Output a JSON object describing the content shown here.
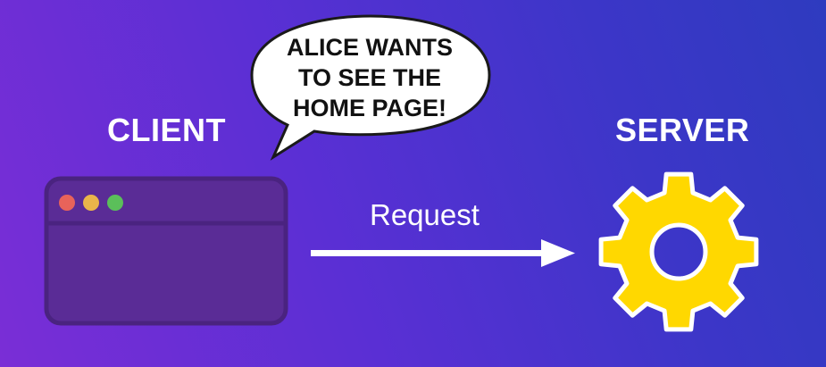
{
  "client": {
    "label": "CLIENT"
  },
  "server": {
    "label": "SERVER"
  },
  "speech_bubble": {
    "text": "ALICE WANTS\nTO SEE THE\nHOME PAGE!"
  },
  "arrow": {
    "label": "Request"
  },
  "colors": {
    "background_start": "#7a2ed6",
    "background_end": "#2e3bbf",
    "window_fill": "#5a2c96",
    "window_border": "#4a2380",
    "dot_red": "#e8635a",
    "dot_yellow": "#e9b54a",
    "dot_green": "#5bbf5a",
    "gear_fill": "#ffd800",
    "gear_outline": "#ffffff",
    "arrow": "#ffffff"
  },
  "icons": {
    "browser": "browser-window-icon",
    "gear": "gear-icon"
  }
}
